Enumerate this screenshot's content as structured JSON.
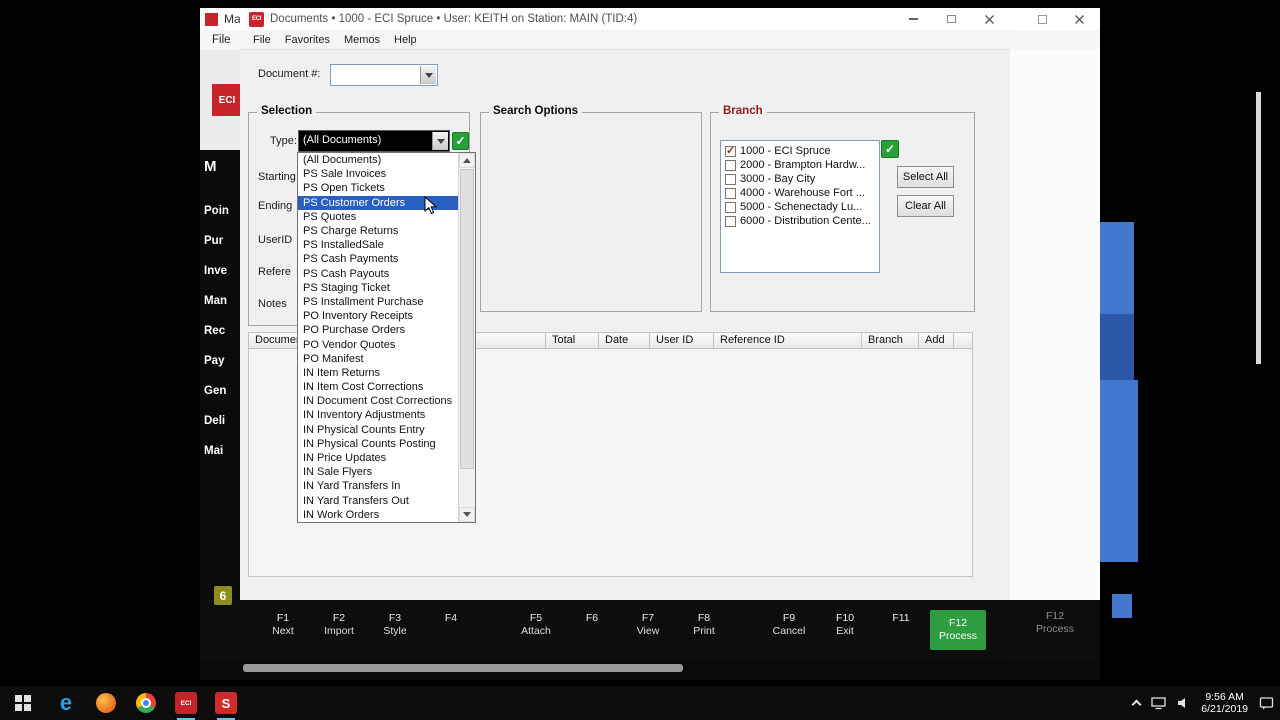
{
  "colors": {
    "eci_red": "#c8242c",
    "selection_highlight_blue": "#2a5fc2",
    "confirm_green": "#27a23b",
    "f12_green": "#2f9e41",
    "branch_check_red": "#b22318",
    "window_bg": "#f0f0f0"
  },
  "window": {
    "title": "Documents • 1000 - ECI Spruce • User: KEITH on Station: MAIN (TID:4)",
    "logo_text": "ECI",
    "menu": [
      "File",
      "Favorites",
      "Memos",
      "Help"
    ],
    "document_field": {
      "label": "Document #:",
      "value": ""
    },
    "selection": {
      "label": "Selection",
      "type_label": "Type:",
      "type_value": "(All Documents)",
      "field_labels": [
        "Starting",
        "Ending",
        "UserID",
        "Refere",
        "Notes"
      ]
    },
    "search_options": {
      "label": "Search Options"
    },
    "branch": {
      "label": "Branch",
      "select_all": "Select All",
      "clear_all": "Clear All",
      "items": [
        {
          "label": "1000 - ECI Spruce",
          "checked": true
        },
        {
          "label": "2000 - Brampton Hardw...",
          "checked": false
        },
        {
          "label": "3000 - Bay City",
          "checked": false
        },
        {
          "label": "4000 - Warehouse Fort ...",
          "checked": false
        },
        {
          "label": "5000 - Schenectady Lu...",
          "checked": false
        },
        {
          "label": "6000 - Distribution Cente...",
          "checked": false
        }
      ]
    },
    "table": {
      "columns": [
        "Document #",
        "Total",
        "Date",
        "User ID",
        "Reference ID",
        "Branch",
        "Add"
      ]
    },
    "function_keys": [
      {
        "key": "F1",
        "label": "Next"
      },
      {
        "key": "F2",
        "label": "Import"
      },
      {
        "key": "F3",
        "label": "Style"
      },
      {
        "key": "F4",
        "label": ""
      },
      {
        "key": "F5",
        "label": "Attach"
      },
      {
        "key": "F6",
        "label": ""
      },
      {
        "key": "F7",
        "label": "View"
      },
      {
        "key": "F8",
        "label": "Print"
      },
      {
        "key": "F9",
        "label": "Cancel"
      },
      {
        "key": "F10",
        "label": "Exit"
      },
      {
        "key": "F11",
        "label": ""
      },
      {
        "key": "F12",
        "label": "Process"
      }
    ]
  },
  "dropdown": {
    "selected": "PS Customer Orders",
    "selected_index": 3,
    "items": [
      "(All Documents)",
      "PS Sale Invoices",
      "PS Open Tickets",
      "PS Customer Orders",
      "PS Quotes",
      "PS Charge Returns",
      "PS InstalledSale",
      "PS Cash Payments",
      "PS Cash Payouts",
      "PS Staging Ticket",
      "PS Installment Purchase",
      "PO Inventory Receipts",
      "PO Purchase Orders",
      "PO Vendor Quotes",
      "PO Manifest",
      "IN Item Returns",
      "IN Item Cost Corrections",
      "IN Document Cost Corrections",
      "IN Inventory Adjustments",
      "IN Physical Counts Entry",
      "IN Physical Counts Posting",
      "IN Price Updates",
      "IN Sale Flyers",
      "IN Yard Transfers In",
      "IN Yard Transfers Out",
      "IN Work Orders"
    ]
  },
  "background_window": {
    "title": "Mai",
    "menu_text": "File   H",
    "logo_text": "ECI",
    "sidebar_header": "M",
    "sidebar": [
      "Poin",
      "Pur",
      "Inve",
      "Man",
      "Rec",
      "Pay",
      "Gen",
      "Deli",
      "Mai"
    ],
    "fkey": {
      "key": "F12",
      "label": "Process"
    },
    "badge": "6"
  },
  "taskbar": {
    "time": "9:56 AM",
    "date": "6/21/2019",
    "eci_icon_text": "ECI",
    "spruce_icon_text": "S"
  }
}
